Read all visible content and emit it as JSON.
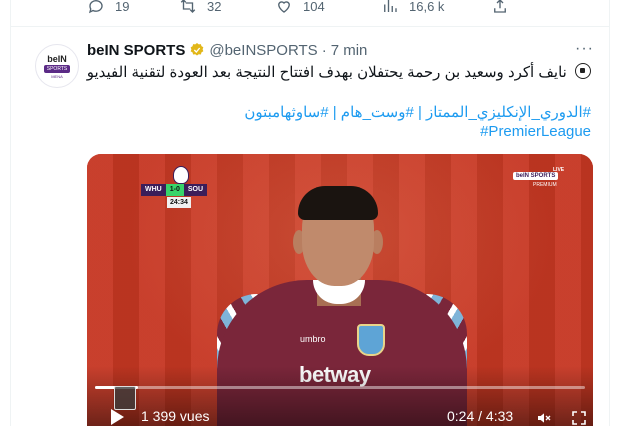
{
  "previous_tweet": {
    "replies": "19",
    "retweets": "32",
    "likes": "104",
    "views": "16,6 k"
  },
  "tweet": {
    "avatar": {
      "line1": "beIN",
      "line2": "SPORTS",
      "line3": "MENA"
    },
    "author_name": "beIN SPORTS",
    "handle": "@beINSPORTS",
    "separator": "·",
    "time": "7 min",
    "more": "···",
    "text_line1": "نايف أكرد وسعيد بن رحمة يحتفلان بهدف افتتاح النتيجة بعد العودة لتقنية الفيديو",
    "hashtags_line": "#الدوري_الإنكليزي_الممتاز | #وست_هام | #ساوثهامبتون",
    "hashtag_en": "#PremierLeague"
  },
  "video": {
    "scoreboard": {
      "home": "WHU",
      "score": "1-0",
      "away": "SOU",
      "clock": "24:34"
    },
    "broadcaster": {
      "logo": "beIN SPORTS",
      "sub": "PREMIUM",
      "live": "LIVE"
    },
    "sponsor": "betway",
    "kit_brand": "umbro",
    "views_label": "1 399 vues",
    "time_label": "0:24 / 4:33",
    "progress": 0.088
  },
  "colors": {
    "link": "#1d9bf0",
    "muted": "#536471",
    "verified_gold": "#e2b719"
  },
  "icons": [
    "reply-icon",
    "retweet-icon",
    "like-icon",
    "views-icon",
    "share-icon",
    "verified-icon",
    "play-icon",
    "volume-icon",
    "fullscreen-icon"
  ]
}
